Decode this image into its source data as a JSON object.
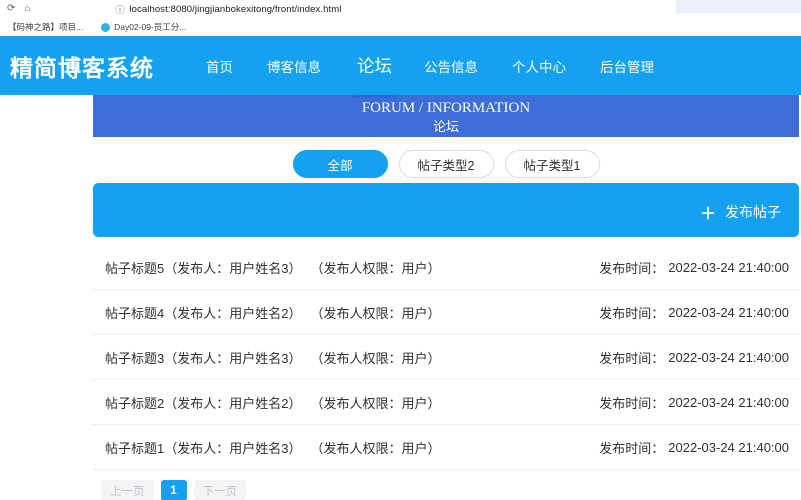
{
  "browser": {
    "url": "localhost:8080/jingjianbokexitong/front/index.html",
    "reload_icon": "⟳",
    "home_icon": "⌂",
    "info_icon": "ⓘ",
    "bookmarks": [
      {
        "label": "【码神之路】项目..."
      },
      {
        "label": "Day02-09-员工分..."
      }
    ]
  },
  "header": {
    "title": "精简博客系统",
    "nav": [
      {
        "label": "首页",
        "active": false
      },
      {
        "label": "博客信息",
        "active": false
      },
      {
        "label": "论坛",
        "active": true
      },
      {
        "label": "公告信息",
        "active": false
      },
      {
        "label": "个人中心",
        "active": false
      },
      {
        "label": "后台管理",
        "active": false
      }
    ]
  },
  "banner": {
    "title_en": "FORUM / INFORMATION",
    "title_zh": "论坛"
  },
  "filters": [
    {
      "label": "全部",
      "active": true
    },
    {
      "label": "帖子类型2",
      "active": false
    },
    {
      "label": "帖子类型1",
      "active": false
    }
  ],
  "action_bar": {
    "plus": "＋",
    "publish_label": "发布帖子"
  },
  "posts": [
    {
      "title": "帖子标题5（发布人：用户姓名3）",
      "permission": "（发布人权限：用户）",
      "time_label": "发布时间：",
      "time_value": "2022-03-24 21:40:00"
    },
    {
      "title": "帖子标题4（发布人：用户姓名2）",
      "permission": "（发布人权限：用户）",
      "time_label": "发布时间：",
      "time_value": "2022-03-24 21:40:00"
    },
    {
      "title": "帖子标题3（发布人：用户姓名3）",
      "permission": "（发布人权限：用户）",
      "time_label": "发布时间：",
      "time_value": "2022-03-24 21:40:00"
    },
    {
      "title": "帖子标题2（发布人：用户姓名2）",
      "permission": "（发布人权限：用户）",
      "time_label": "发布时间：",
      "time_value": "2022-03-24 21:40:00"
    },
    {
      "title": "帖子标题1（发布人：用户姓名3）",
      "permission": "（发布人权限：用户）",
      "time_label": "发布时间：",
      "time_value": "2022-03-24 21:40:00"
    }
  ],
  "pagination": {
    "prev": "上一页",
    "page": "1",
    "next": "下一页"
  },
  "colors": {
    "azure": "#14a1f0",
    "banner_blue": "#3d6ed8",
    "nav_underline": "#2d66d8",
    "text": "#303133",
    "dotted_divider": "#dcdfe6",
    "pagination_disabled_bg": "#f4f4f5",
    "pagination_disabled_text": "#c0c4cc"
  }
}
